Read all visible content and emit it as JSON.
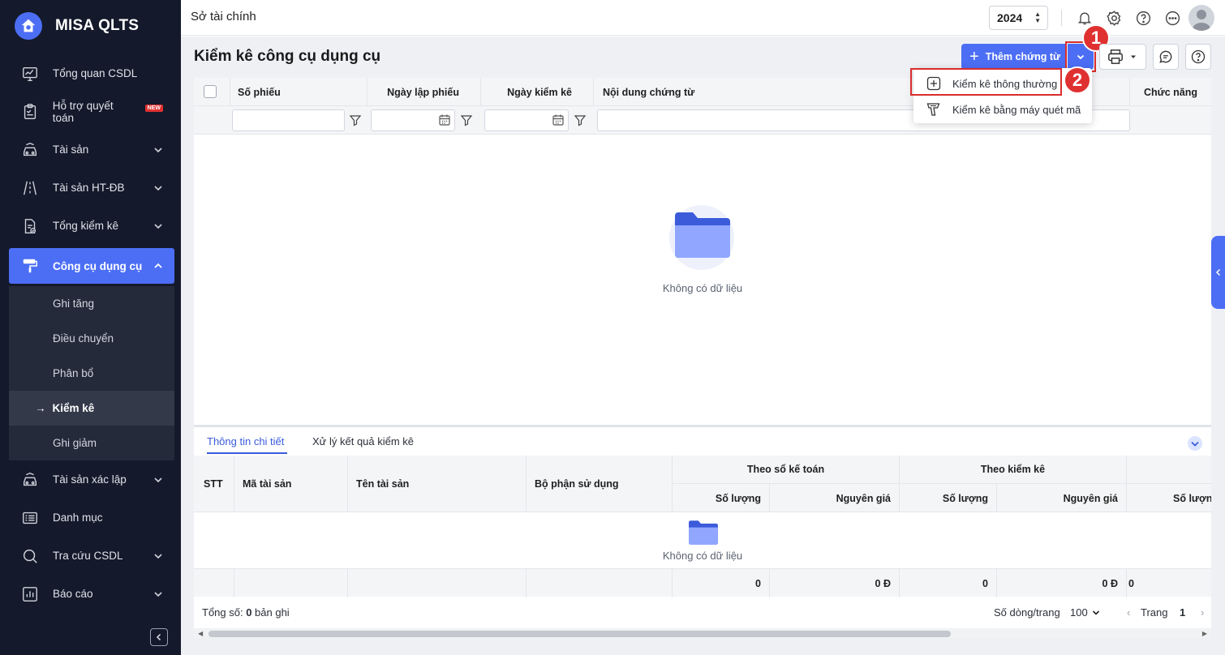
{
  "app": {
    "name": "MISA QLTS"
  },
  "sidebar": {
    "items": [
      {
        "label": "Tổng quan CSDL",
        "icon": "monitor-chart-icon",
        "chevron": false
      },
      {
        "label": "Hỗ trợ quyết toán",
        "icon": "clipboard-check-icon",
        "badge": "NEW",
        "chevron": false
      },
      {
        "label": "Tài sản",
        "icon": "car-icon",
        "chevron": true
      },
      {
        "label": "Tài sản HT-ĐB",
        "icon": "road-icon",
        "chevron": true
      },
      {
        "label": "Tổng kiểm kê",
        "icon": "document-check-icon",
        "chevron": true
      }
    ],
    "active": {
      "label": "Công cụ dụng cụ",
      "icon": "paint-roller-icon"
    },
    "subitems": [
      "Ghi tăng",
      "Điều chuyển",
      "Phân bổ",
      "Kiểm kê",
      "Ghi giảm"
    ],
    "current_sub_arrow": "→",
    "items_after": [
      {
        "label": "Tài sản xác lập",
        "icon": "car-stack-icon",
        "chevron": true
      },
      {
        "label": "Danh mục",
        "icon": "list-icon",
        "chevron": false
      },
      {
        "label": "Tra cứu CSDL",
        "icon": "search-icon",
        "chevron": true
      },
      {
        "label": "Báo cáo",
        "icon": "bar-chart-icon",
        "chevron": true
      }
    ]
  },
  "topbar": {
    "title": "Sở tài chính",
    "year": "2024"
  },
  "page": {
    "title": "Kiểm kê công cụ dụng cụ",
    "add_button": "Thêm chứng từ",
    "steps": [
      "1",
      "2"
    ]
  },
  "menu": {
    "items": [
      {
        "label": "Kiểm kê thông thường",
        "icon": "plus-square-icon"
      },
      {
        "label": "Kiểm kê bằng máy quét mã",
        "icon": "barcode-scanner-icon"
      }
    ]
  },
  "grid": {
    "columns": [
      "Số phiếu",
      "Ngày lập phiếu",
      "Ngày kiểm kê",
      "Nội dung chứng từ",
      "Chức năng"
    ],
    "empty_text": "Không có dữ liệu"
  },
  "detail": {
    "tabs": [
      "Thông tin chi tiết",
      "Xử lý kết quả kiểm kê"
    ],
    "columns": {
      "stt": "STT",
      "ma_tai_san": "Mã tài sản",
      "ten_tai_san": "Tên tài sản",
      "bo_phan": "Bộ phận sử dụng",
      "group1": "Theo sổ kế toán",
      "group2": "Theo kiểm kê",
      "so_luong": "Số lượng",
      "nguyen_gia": "Nguyên giá",
      "so_luong_cut": "Số lượng"
    },
    "empty_text": "Không có dữ liệu",
    "totals": [
      "0",
      "0 Đ",
      "0",
      "0 Đ",
      "0"
    ]
  },
  "pager": {
    "total_prefix": "Tổng số: ",
    "total_count": "0",
    "total_suffix": " bản ghi",
    "rows_label": "Số dòng/trang",
    "rows_value": "100",
    "page_label": "Trang",
    "page_value": "1"
  },
  "colors": {
    "accent": "#4c6ef5",
    "sidebar_bg": "#141a2b",
    "highlight": "#d92d2d"
  }
}
